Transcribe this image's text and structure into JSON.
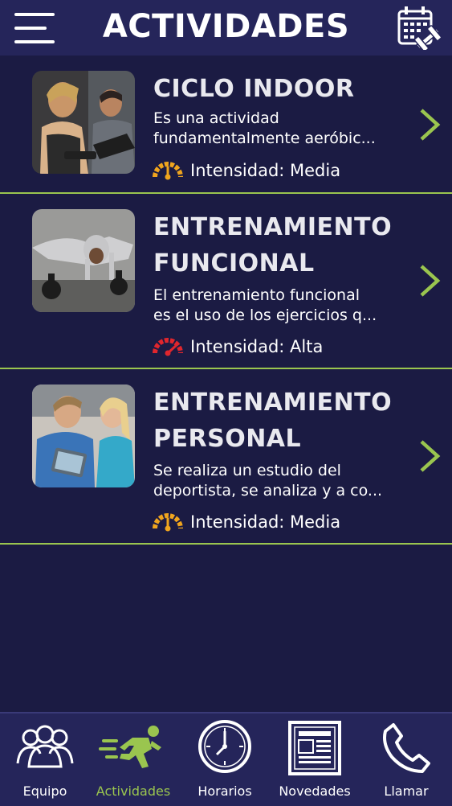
{
  "header": {
    "title": "ACTIVIDADES",
    "menu_icon": "hamburger-menu-icon",
    "right_icon": "calendar-dumbbell-icon"
  },
  "activities": [
    {
      "title_lines": [
        "CICLO INDOOR"
      ],
      "description_lines": [
        "Es una actividad",
        "fundamentalmente aeróbic..."
      ],
      "intensity": "Intensidad: Media",
      "intensity_color": "#f0a51e"
    },
    {
      "title_lines": [
        "ENTRENAMIENTO",
        "FUNCIONAL"
      ],
      "description_lines": [
        "El entrenamiento funcional",
        "es el uso de los ejercicios q..."
      ],
      "intensity": "Intensidad: Alta",
      "intensity_color": "#e1262d"
    },
    {
      "title_lines": [
        "ENTRENAMIENTO",
        "PERSONAL"
      ],
      "description_lines": [
        "Se realiza un estudio del",
        "deportista, se analiza y a co..."
      ],
      "intensity": "Intensidad: Media",
      "intensity_color": "#f0a51e"
    }
  ],
  "bottom_nav": [
    {
      "label": "Equipo",
      "icon": "team-icon",
      "active": false
    },
    {
      "label": "Actividades",
      "icon": "running-person-icon",
      "active": true
    },
    {
      "label": "Horarios",
      "icon": "clock-icon",
      "active": false
    },
    {
      "label": "Novedades",
      "icon": "newspaper-icon",
      "active": false
    },
    {
      "label": "Llamar",
      "icon": "phone-icon",
      "active": false
    }
  ],
  "colors": {
    "background": "#1b1b43",
    "bar": "#25255a",
    "accent": "#9ac54f",
    "text": "#ffffff"
  }
}
